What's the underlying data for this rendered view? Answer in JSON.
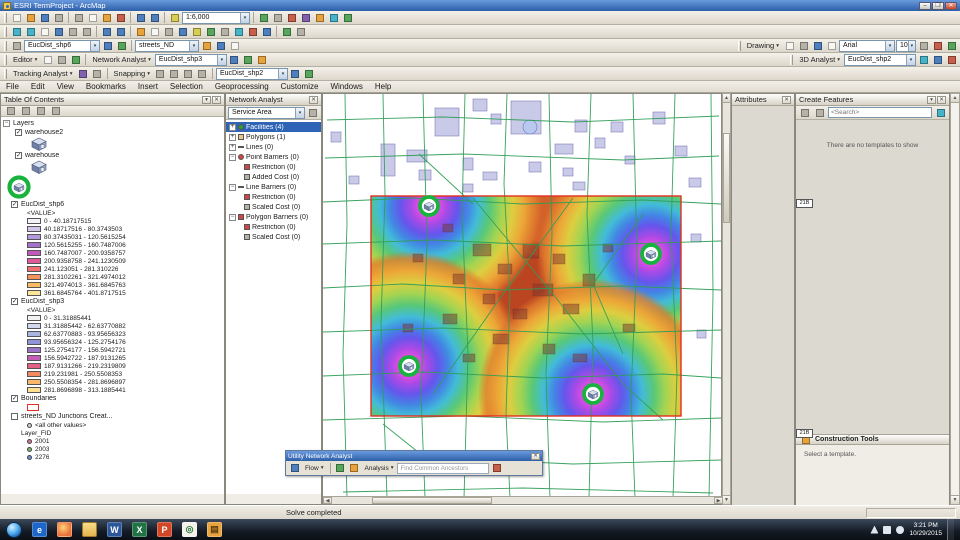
{
  "window": {
    "title": "ESRI TermProject - ArcMap"
  },
  "menu": {
    "items": [
      "File",
      "Edit",
      "View",
      "Bookmarks",
      "Insert",
      "Selection",
      "Geoprocessing",
      "Customize",
      "Windows",
      "Help"
    ]
  },
  "toolbars": {
    "scale": "1:6,000",
    "layer_combo_1": "EucDist_shp6",
    "layer_combo_2": "streets_ND",
    "layer_combo_3": "EucDist_shp3",
    "layer_combo_4": "EucDist_shp2",
    "layer_combo_5": "EucDist_shp2",
    "editor_label": "Editor",
    "network_analyst_label": "Network Analyst",
    "tracking_analyst_label": "Tracking Analyst",
    "snapping_label": "Snapping",
    "drawing_label": "Drawing",
    "analyst_3d_label": "3D Analyst",
    "font_name": "Arial",
    "font_size": "10"
  },
  "toc": {
    "title": "Table Of Contents",
    "root_label": "Layers",
    "warehouse2_label": "warehouse2",
    "warehouse_label": "warehouse",
    "eucdist6": {
      "name": "EucDist_shp6",
      "value_label": "<VALUE>",
      "classes": [
        {
          "color": "#f4f1fb",
          "label": "0 - 40.18717515"
        },
        {
          "color": "#d4c6ea",
          "label": "40.18717516 - 80.3743503"
        },
        {
          "color": "#b29add",
          "label": "80.37435031 - 120.5615254"
        },
        {
          "color": "#a671cc",
          "label": "120.5615255 - 160.7487006"
        },
        {
          "color": "#c159bd",
          "label": "160.7487007 - 200.9358757"
        },
        {
          "color": "#df5a9d",
          "label": "200.9358758 - 241.1230509"
        },
        {
          "color": "#ef6f72",
          "label": "241.123051 - 281.310226"
        },
        {
          "color": "#f6935a",
          "label": "281.3102261 - 321.4974012"
        },
        {
          "color": "#fbbb63",
          "label": "321.4974013 - 361.6845763"
        },
        {
          "color": "#fde599",
          "label": "361.6845764 - 401.8717515"
        }
      ]
    },
    "eucdist3": {
      "name": "EucDist_shp3",
      "value_label": "<VALUE>",
      "classes": [
        {
          "color": "#f2f2f0",
          "label": "0 - 31.31885441"
        },
        {
          "color": "#d2d8ee",
          "label": "31.31885442 - 62.63770882"
        },
        {
          "color": "#aab6e2",
          "label": "62.63770883 - 93.95656323"
        },
        {
          "color": "#8e94d6",
          "label": "93.95656324 - 125.2754176"
        },
        {
          "color": "#9c74c6",
          "label": "125.2754177 - 156.5942721"
        },
        {
          "color": "#c55eb6",
          "label": "156.5942722 - 187.9131265"
        },
        {
          "color": "#e46186",
          "label": "187.9131266 - 219.2319809"
        },
        {
          "color": "#f28960",
          "label": "219.231981 - 250.5508353"
        },
        {
          "color": "#f9b86a",
          "label": "250.5508354 - 281.8696897"
        },
        {
          "color": "#fde18e",
          "label": "281.8696898 - 313.1885441"
        }
      ]
    },
    "boundaries_label": "Boundaries",
    "streets": {
      "name": "streets_ND Junctions Creat...",
      "all_other_label": "<all other values>",
      "field_label": "Layer_FID",
      "values": [
        {
          "color": "#d96fa0",
          "label": "2001"
        },
        {
          "color": "#7fb86a",
          "label": "2003"
        },
        {
          "color": "#6f8fd9",
          "label": "2276"
        }
      ]
    }
  },
  "network_analyst_panel": {
    "title": "Network Analyst",
    "mode": "Service Area",
    "items": [
      {
        "label": "Facilities (4)"
      },
      {
        "label": "Polygons (1)"
      },
      {
        "label": "Lines (0)"
      },
      {
        "label": "Point Barriers (0)"
      },
      {
        "label": "Restriction (0)"
      },
      {
        "label": "Added Cost (0)"
      },
      {
        "label": "Line Barriers (0)"
      },
      {
        "label": "Restriction (0)"
      },
      {
        "label": "Scaled Cost (0)"
      },
      {
        "label": "Polygon Barriers (0)"
      },
      {
        "label": "Restriction (0)"
      },
      {
        "label": "Scaled Cost (0)"
      }
    ]
  },
  "attributes_panel": {
    "title": "Attributes"
  },
  "create_features": {
    "title": "Create Features",
    "search_placeholder": "<Search>",
    "empty_text": "There are no templates to show",
    "construction_title": "Construction Tools",
    "construction_hint": "Select a template."
  },
  "utility_toolbar": {
    "title": "Utility Network Analyst",
    "flow_label": "Flow",
    "analysis_label": "Analysis",
    "task_value": "Find Common Ancestors"
  },
  "map": {
    "tag_top": "21B",
    "tag_bottom": "21B",
    "facility_count": 4,
    "marker_color": "#17b33c",
    "boundary_color": "#e03020"
  },
  "statusbar": {
    "message": "Solve completed"
  },
  "taskbar": {
    "time": "3:21 PM",
    "date": "10/29/2015"
  }
}
